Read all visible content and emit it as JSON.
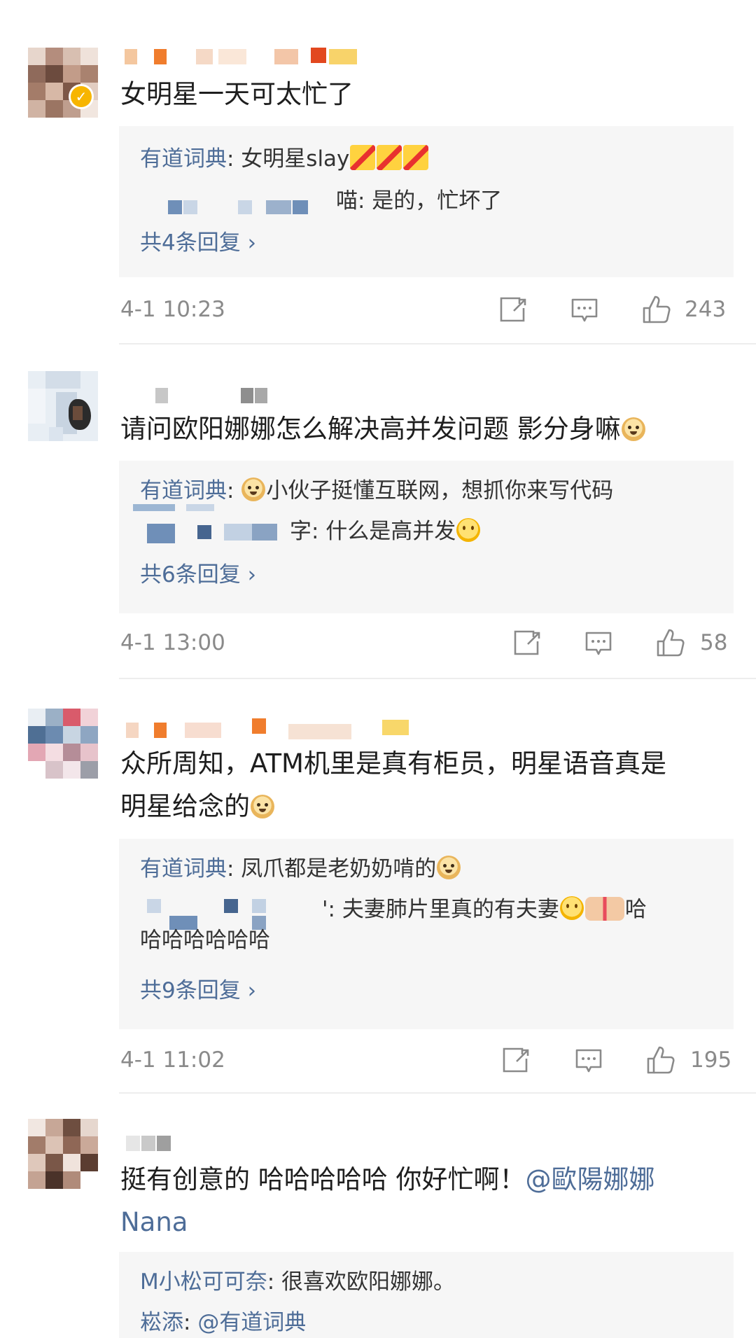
{
  "comments": [
    {
      "text": "女明星一天可太忙了",
      "replies": [
        {
          "name": "有道词典",
          "text": ": 女明星slay"
        },
        {
          "name": "",
          "text": "喵: 是的，忙坏了"
        }
      ],
      "more": "共4条回复 ›",
      "time": "4-1 10:23",
      "likes": "243"
    },
    {
      "text": "请问欧阳娜娜怎么解决高并发问题 影分身嘛",
      "replies": [
        {
          "name": "有道词典",
          "text": ": 小伙子挺懂互联网，想抓你来写代码"
        },
        {
          "name": "",
          "text": "字: 什么是高并发"
        }
      ],
      "more": "共6条回复 ›",
      "time": "4-1 13:00",
      "likes": "58"
    },
    {
      "text_line1": "众所周知，ATM机里是真有柜员，明星语音真是",
      "text_line2": "明星给念的",
      "replies": [
        {
          "name": "有道词典",
          "text": ": 凤爪都是老奶奶啃的"
        },
        {
          "name": "",
          "text": "': 夫妻肺片里真的有夫妻",
          "text_tail": "哈",
          "text_line2": "哈哈哈哈哈哈"
        }
      ],
      "more": "共9条回复 ›",
      "time": "4-1 11:02",
      "likes": "195"
    },
    {
      "text_line1": "挺有创意的 哈哈哈哈哈 你好忙啊！",
      "mention_line1": "@歐陽娜娜",
      "mention_line2": "Nana",
      "replies": [
        {
          "name": "M小松可可奈",
          "text": ": 很喜欢欧阳娜娜。"
        },
        {
          "name": "崧添",
          "text": ": ",
          "mention": "@有道词典"
        }
      ]
    }
  ],
  "icons": {
    "share": "share-icon",
    "comment": "comment-icon",
    "like": "thumbs-up-icon",
    "verified": "verified-badge-icon"
  },
  "colors": {
    "link": "#4e6d98",
    "meta": "#8a8a8a",
    "reply_bg": "#f6f6f6",
    "verified": "#f7b500"
  }
}
